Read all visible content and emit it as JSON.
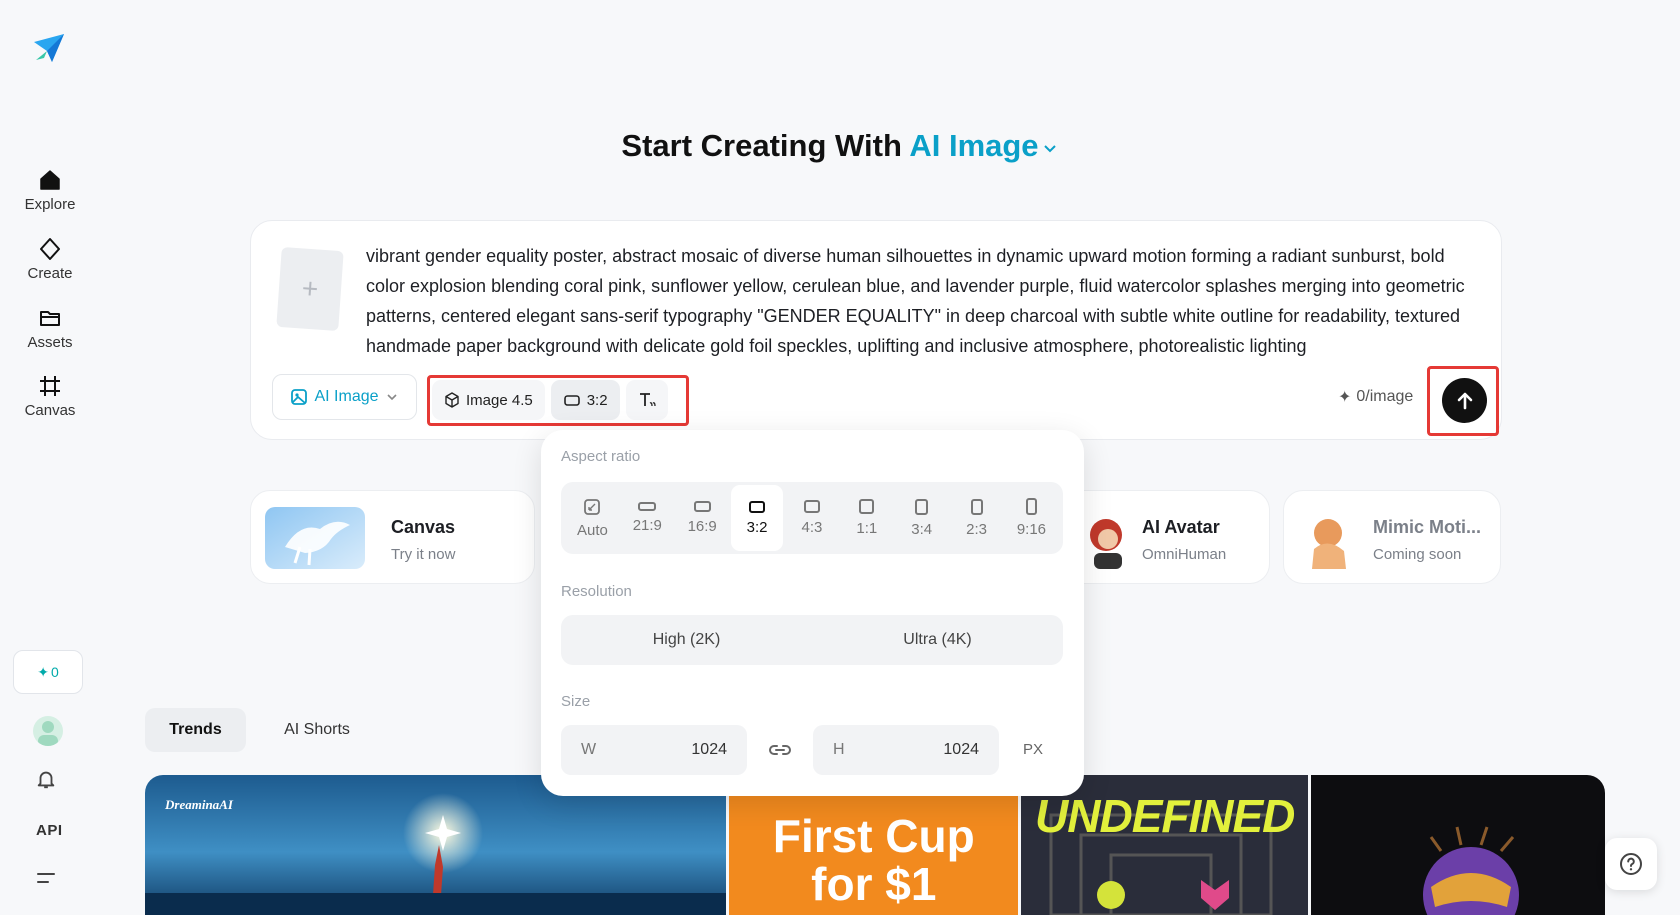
{
  "sidebar": {
    "nav": [
      {
        "label": "Explore",
        "icon": "home-icon"
      },
      {
        "label": "Create",
        "icon": "sparkle-diamond-icon"
      },
      {
        "label": "Assets",
        "icon": "folder-icon"
      },
      {
        "label": "Canvas",
        "icon": "frame-icon"
      }
    ],
    "credits": "0",
    "api_label": "API"
  },
  "headline": {
    "prefix": "Start Creating With",
    "accent": "AI Image"
  },
  "prompt": {
    "text": "vibrant gender equality poster, abstract mosaic of diverse human silhouettes in dynamic upward motion forming a radiant sunburst, bold color explosion blending coral pink, sunflower yellow, cerulean blue, and lavender purple, fluid watercolor splashes merging into geometric patterns, centered elegant sans-serif typography \"GENDER EQUALITY\" in deep charcoal with subtle white outline for readability, textured handmade paper background with delicate gold foil speckles, uplifting and inclusive atmosphere, photorealistic lighting",
    "mode_label": "AI Image",
    "model_label": "Image 4.5",
    "ratio_label": "3:2",
    "cost_label": "0/image"
  },
  "popover": {
    "aspect_title": "Aspect ratio",
    "ratios": [
      "Auto",
      "21:9",
      "16:9",
      "3:2",
      "4:3",
      "1:1",
      "3:4",
      "2:3",
      "9:16"
    ],
    "selected_ratio": "3:2",
    "resolution_title": "Resolution",
    "resolutions": [
      "High (2K)",
      "Ultra (4K)"
    ],
    "size_title": "Size",
    "width_label": "W",
    "width_value": "1024",
    "height_label": "H",
    "height_value": "1024",
    "unit": "PX"
  },
  "features": [
    {
      "title": "Canvas",
      "sub": "Try it now"
    },
    {
      "title": "AI Avatar",
      "sub": "OmniHuman"
    },
    {
      "title": "Mimic Moti...",
      "sub": "Coming soon"
    }
  ],
  "tabs": [
    "Trends",
    "AI Shorts"
  ],
  "gallery": {
    "watermark": "DreaminaAI",
    "promo_line1": "First Cup",
    "promo_line2": "for $1",
    "poster_title": "UNDEFINED"
  },
  "colors": {
    "accent": "#0aa0c8",
    "highlight": "#e53935"
  }
}
